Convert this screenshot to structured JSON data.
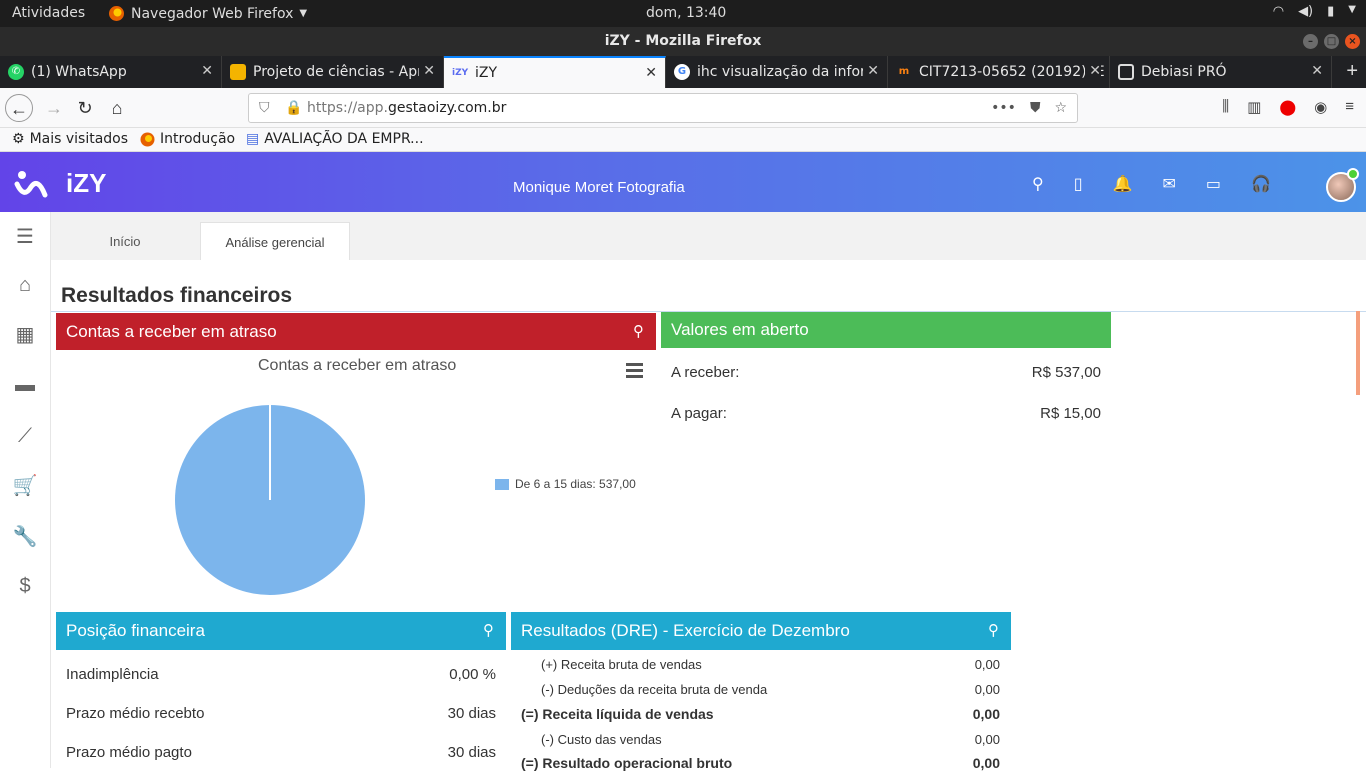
{
  "system": {
    "activities": "Atividades",
    "app_menu": "Navegador Web Firefox",
    "clock": "dom, 13:40"
  },
  "window": {
    "title": "iZY - Mozilla Firefox"
  },
  "tabs": [
    {
      "label": "(1) WhatsApp"
    },
    {
      "label": "Projeto de ciências - Apr"
    },
    {
      "label": "iZY"
    },
    {
      "label": "ihc visualização da infor"
    },
    {
      "label": "CIT7213-05652 (20192): E"
    },
    {
      "label": "Debiasi PRÓ"
    }
  ],
  "url": {
    "prefix": "https://app.",
    "domain": "gestaoizy.com.br"
  },
  "bookmarks": [
    {
      "label": "Mais visitados"
    },
    {
      "label": "Introdução"
    },
    {
      "label": "AVALIAÇÃO DA EMPR..."
    }
  ],
  "app": {
    "logo": "iZY",
    "company": "Monique Moret Fotografia",
    "tabs": [
      "Início",
      "Análise gerencial"
    ],
    "page_title": "Resultados financeiros"
  },
  "contas_atraso": {
    "header": "Contas a receber em atraso",
    "chart_title": "Contas a receber em atraso"
  },
  "chart_data": {
    "type": "pie",
    "title": "Contas a receber em atraso",
    "slices": [
      {
        "name": "De 6 a 15 dias: 537,00",
        "value": 537.0,
        "color": "#7cb5ec"
      }
    ]
  },
  "valores_aberto": {
    "header": "Valores em aberto",
    "rows": [
      {
        "label": "A receber:",
        "value": "R$ 537,00"
      },
      {
        "label": "A pagar:",
        "value": "R$ 15,00"
      }
    ]
  },
  "posicao": {
    "header": "Posição financeira",
    "rows": [
      {
        "label": "Inadimplência",
        "value": "0,00 %"
      },
      {
        "label": "Prazo médio recebto",
        "value": "30 dias"
      },
      {
        "label": "Prazo médio pagto",
        "value": "30 dias"
      }
    ]
  },
  "dre": {
    "header": "Resultados (DRE) - Exercício de Dezembro",
    "rows": [
      {
        "label": "(+) Receita bruta de vendas",
        "value": "0,00"
      },
      {
        "label": "(-) Deduções da receita bruta de venda",
        "value": "0,00"
      },
      {
        "label": "(=) Receita líquida de vendas",
        "value": "0,00"
      },
      {
        "label": "(-) Custo das vendas",
        "value": "0,00"
      },
      {
        "label": "(=) Resultado operacional bruto",
        "value": "0,00"
      }
    ]
  }
}
